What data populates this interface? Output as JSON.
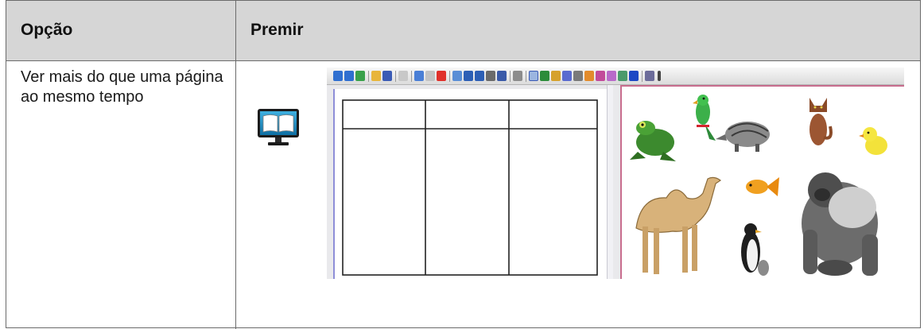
{
  "table": {
    "header": {
      "option": "Opção",
      "press": "Premir"
    },
    "row": {
      "option_text": "Ver mais do que uma página ao mesmo tempo"
    }
  },
  "icons": {
    "row_icon": "dual-page-monitor-icon"
  },
  "screenshot": {
    "description_icons": [
      "back-arrow-icon",
      "forward-arrow-icon",
      "refresh-icon",
      "folder-icon",
      "save-icon",
      "page-icon",
      "undo-icon",
      "redo-icon",
      "delete-icon",
      "screen-icon",
      "dual-screen-icon",
      "monitor-icon",
      "table-icon",
      "select-icon",
      "pen-icon",
      "highlighter-icon",
      "eraser-icon",
      "line-icon",
      "fill-icon",
      "magic-pen-icon",
      "shape-icon",
      "text-icon",
      "capture-icon"
    ],
    "colors": {
      "left_border": "#8e8ed8",
      "right_border": "#c86d8e"
    }
  }
}
